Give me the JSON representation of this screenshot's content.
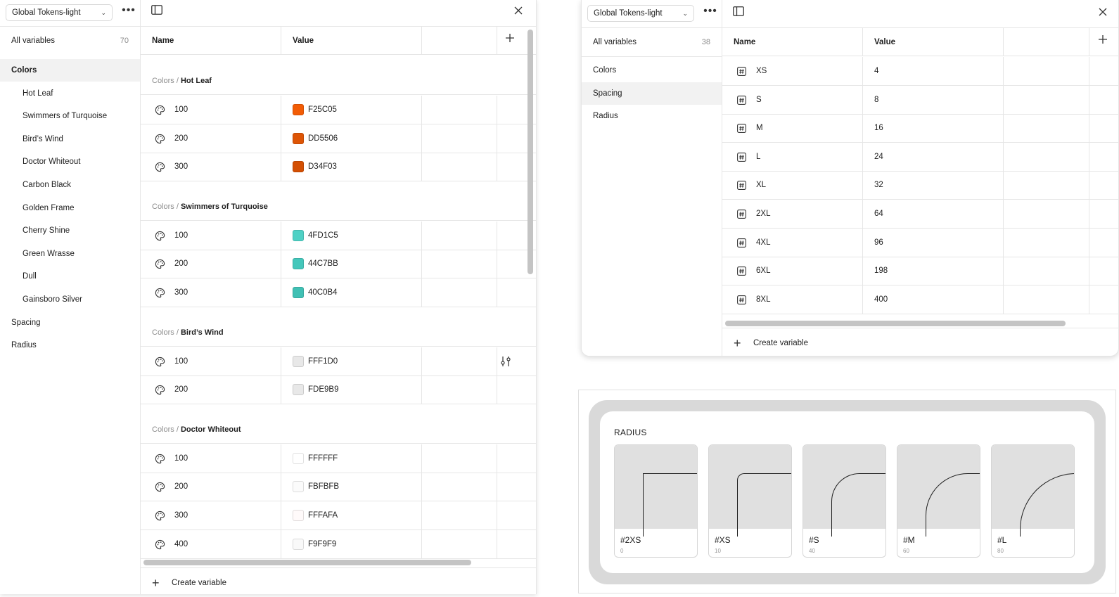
{
  "left_panel": {
    "collection": "Global Tokens-light",
    "all_variables_label": "All variables",
    "all_variables_count": "70",
    "sidebar": [
      {
        "label": "Colors",
        "level": 0,
        "active": true
      },
      {
        "label": "Hot Leaf",
        "level": 1
      },
      {
        "label": "Swimmers of Turquoise",
        "level": 1
      },
      {
        "label": "Bird’s Wind",
        "level": 1
      },
      {
        "label": "Doctor Whiteout",
        "level": 1
      },
      {
        "label": "Carbon Black",
        "level": 1
      },
      {
        "label": "Golden Frame",
        "level": 1
      },
      {
        "label": "Cherry Shine",
        "level": 1
      },
      {
        "label": "Green Wrasse",
        "level": 1
      },
      {
        "label": "Dull",
        "level": 1
      },
      {
        "label": "Gainsboro Silver",
        "level": 1
      },
      {
        "label": "Spacing",
        "level": 0
      },
      {
        "label": "Radius",
        "level": 0
      }
    ],
    "columns": {
      "name": "Name",
      "value": "Value"
    },
    "groups": [
      {
        "prefix": "Colors / ",
        "title": "Hot Leaf",
        "rows": [
          {
            "name": "100",
            "value": "F25C05",
            "color": "#F25C05"
          },
          {
            "name": "200",
            "value": "DD5506",
            "color": "#DD5506"
          },
          {
            "name": "300",
            "value": "D34F03",
            "color": "#D34F03"
          }
        ]
      },
      {
        "prefix": "Colors / ",
        "title": "Swimmers of Turquoise",
        "rows": [
          {
            "name": "100",
            "value": "4FD1C5",
            "color": "#4FD1C5"
          },
          {
            "name": "200",
            "value": "44C7BB",
            "color": "#44C7BB"
          },
          {
            "name": "300",
            "value": "40C0B4",
            "color": "#40C0B4"
          }
        ]
      },
      {
        "prefix": "Colors / ",
        "title": "Bird’s Wind",
        "rows": [
          {
            "name": "100",
            "value": "FFF1D0",
            "color": "#E8E8E8",
            "edit_icon": true
          },
          {
            "name": "200",
            "value": "FDE9B9",
            "color": "#E8E8E8"
          }
        ]
      },
      {
        "prefix": "Colors / ",
        "title": "Doctor Whiteout",
        "rows": [
          {
            "name": "100",
            "value": "FFFFFF",
            "color": "#FFFFFF"
          },
          {
            "name": "200",
            "value": "FBFBFB",
            "color": "#FBFBFB"
          },
          {
            "name": "300",
            "value": "FFFAFA",
            "color": "#FFFAFA"
          },
          {
            "name": "400",
            "value": "F9F9F9",
            "color": "#F9F9F9"
          }
        ]
      }
    ],
    "create_label": "Create variable"
  },
  "right_panel": {
    "collection": "Global Tokens-light",
    "all_variables_label": "All variables",
    "all_variables_count": "38",
    "sidebar": [
      {
        "label": "Colors",
        "level": 0
      },
      {
        "label": "Spacing",
        "level": 0,
        "active": true
      },
      {
        "label": "Radius",
        "level": 0
      }
    ],
    "columns": {
      "name": "Name",
      "value": "Value"
    },
    "rows": [
      {
        "name": "XS",
        "value": "4"
      },
      {
        "name": "S",
        "value": "8"
      },
      {
        "name": "M",
        "value": "16"
      },
      {
        "name": "L",
        "value": "24"
      },
      {
        "name": "XL",
        "value": "32"
      },
      {
        "name": "2XL",
        "value": "64"
      },
      {
        "name": "4XL",
        "value": "96"
      },
      {
        "name": "6XL",
        "value": "198"
      },
      {
        "name": "8XL",
        "value": "400"
      }
    ],
    "create_label": "Create variable"
  },
  "radius_preview": {
    "title": "RADIUS",
    "cards": [
      {
        "name": "#2XS",
        "value": "0",
        "radius": 0
      },
      {
        "name": "#XS",
        "value": "10",
        "radius": 10
      },
      {
        "name": "#S",
        "value": "40",
        "radius": 40
      },
      {
        "name": "#M",
        "value": "60",
        "radius": 60
      },
      {
        "name": "#L",
        "value": "80",
        "radius": 80
      }
    ]
  }
}
